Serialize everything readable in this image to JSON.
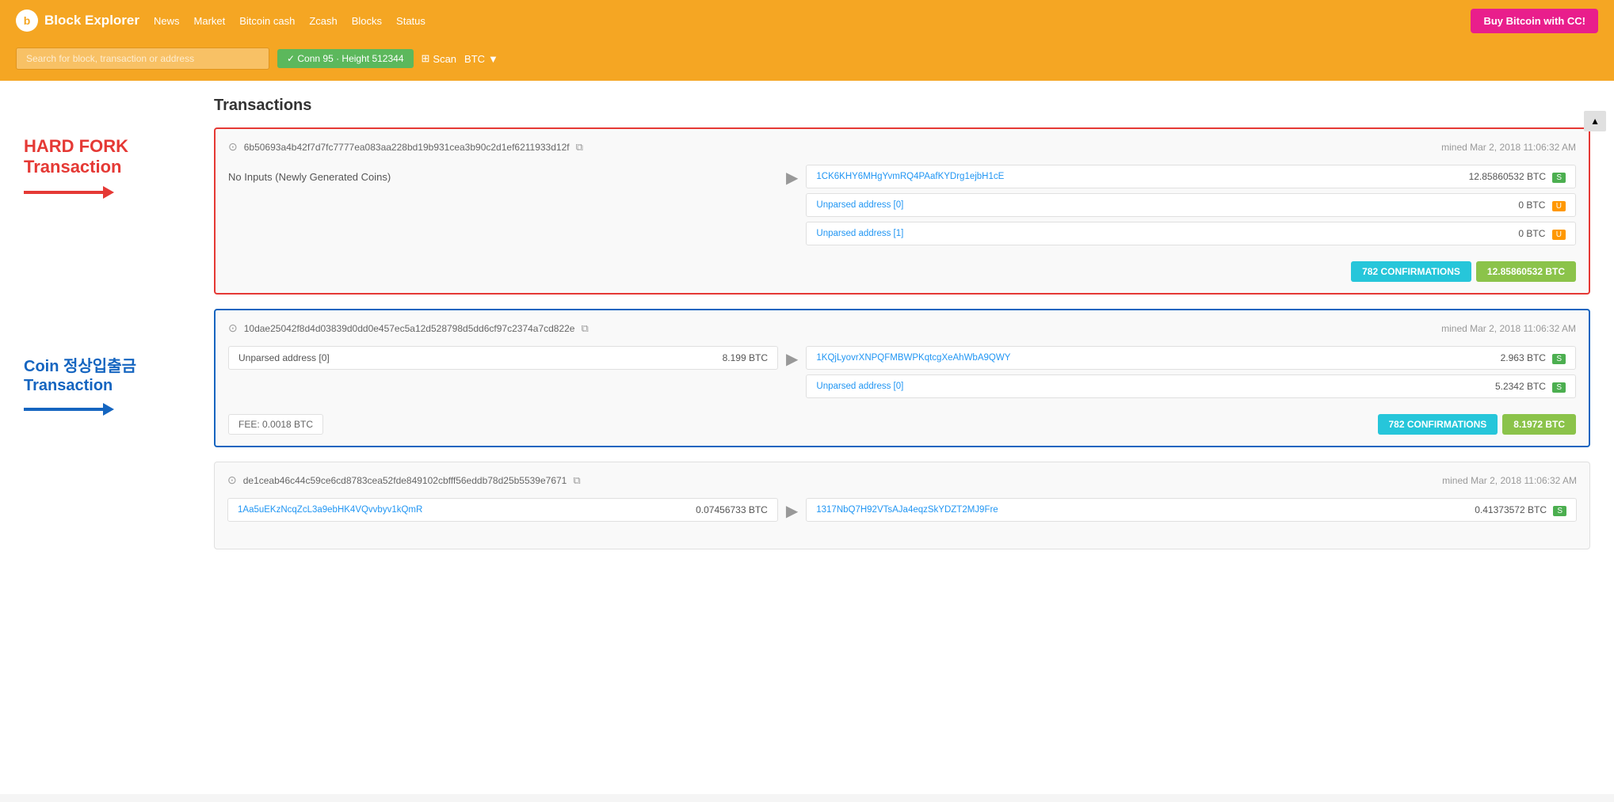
{
  "header": {
    "logo_text": "Block Explorer",
    "logo_letter": "b",
    "nav": {
      "news": "News",
      "market": "Market",
      "bitcoin_cash": "Bitcoin cash",
      "zcash": "Zcash",
      "blocks": "Blocks",
      "status": "Status"
    },
    "buy_btn": "Buy Bitcoin with CC!",
    "search_placeholder": "Search for block, transaction or address",
    "conn_badge": "✓ Conn 95 · Height 512344",
    "scan_label": "Scan",
    "btc_label": "BTC"
  },
  "page": {
    "title": "Transactions"
  },
  "sidebar": {
    "hard_fork_label_line1": "HARD FORK",
    "hard_fork_label_line2": "Transaction",
    "coin_label_line1": "Coin 정상입출금",
    "coin_label_line2": "Transaction"
  },
  "transactions": [
    {
      "id": "tx1",
      "hash": "6b50693a4b42f7d7fc7777ea083aa228bd19b931cea3b90c2d1ef6211933d12f",
      "mined": "mined Mar 2, 2018 11:06:32 AM",
      "inputs": [
        {
          "label": "No Inputs (Newly Generated Coins)",
          "value": ""
        }
      ],
      "outputs": [
        {
          "addr": "1CK6KHY6MHgYvmRQ4PAafKYDrg1ejbH1cE",
          "value": "12.85860532 BTC",
          "badge": "S"
        },
        {
          "addr": "Unparsed address [0]",
          "value": "0 BTC",
          "badge": "U"
        },
        {
          "addr": "Unparsed address [1]",
          "value": "0 BTC",
          "badge": "U"
        }
      ],
      "confirmations": "782 CONFIRMATIONS",
      "total": "12.85860532 BTC",
      "fee": "",
      "border_color": "red"
    },
    {
      "id": "tx2",
      "hash": "10dae25042f8d4d03839d0dd0e457ec5a12d528798d5dd6cf97c2374a7cd822e",
      "mined": "mined Mar 2, 2018 11:06:32 AM",
      "inputs": [
        {
          "label": "Unparsed address [0]",
          "value": "8.199 BTC"
        }
      ],
      "outputs": [
        {
          "addr": "1KQjLyovrXNPQFMBWPKqtcgXeAhWbA9QWY",
          "value": "2.963 BTC",
          "badge": "S"
        },
        {
          "addr": "Unparsed address [0]",
          "value": "5.2342 BTC",
          "badge": "S"
        }
      ],
      "confirmations": "782 CONFIRMATIONS",
      "total": "8.1972 BTC",
      "fee": "FEE: 0.0018 BTC",
      "border_color": "blue"
    },
    {
      "id": "tx3",
      "hash": "de1ceab46c44c59ce6cd8783cea52fde849102cbfff56eddb78d25b5539e7671",
      "mined": "mined Mar 2, 2018 11:06:32 AM",
      "inputs": [
        {
          "label": "1Aa5uEKzNcqZcL3a9ebHK4VQvvbyv1kQmR",
          "value": "0.07456733 BTC"
        }
      ],
      "outputs": [
        {
          "addr": "1317NbQ7H92VTsAJa4eqzSkYDZT2MJ9Fre",
          "value": "0.41373572 BTC",
          "badge": "S"
        }
      ],
      "confirmations": "",
      "total": "",
      "fee": "",
      "border_color": "plain"
    }
  ]
}
